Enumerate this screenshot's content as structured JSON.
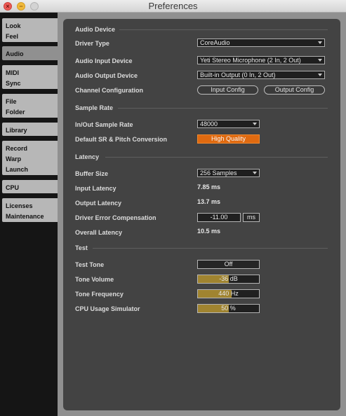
{
  "window": {
    "title": "Preferences"
  },
  "sidebar": {
    "tabs": [
      {
        "lines": [
          "Look",
          "Feel"
        ]
      },
      {
        "lines": [
          "Audio"
        ]
      },
      {
        "lines": [
          "MIDI",
          "Sync"
        ]
      },
      {
        "lines": [
          "File",
          "Folder"
        ]
      },
      {
        "lines": [
          "Library"
        ]
      },
      {
        "lines": [
          "Record",
          "Warp",
          "Launch"
        ]
      },
      {
        "lines": [
          "CPU"
        ]
      },
      {
        "lines": [
          "Licenses",
          "Maintenance"
        ]
      }
    ]
  },
  "audio_device": {
    "section": "Audio Device",
    "driver_type_label": "Driver Type",
    "driver_type_value": "CoreAudio",
    "input_device_label": "Audio Input Device",
    "input_device_value": "Yeti Stereo Microphone (2 In, 2 Out)",
    "output_device_label": "Audio Output Device",
    "output_device_value": "Built-in Output (0 In, 2 Out)",
    "channel_config_label": "Channel Configuration",
    "input_config_button": "Input Config",
    "output_config_button": "Output Config"
  },
  "sample_rate": {
    "section": "Sample Rate",
    "in_out_label": "In/Out Sample Rate",
    "in_out_value": "48000",
    "default_sr_label": "Default SR & Pitch Conversion",
    "default_sr_value": "High Quality"
  },
  "latency": {
    "section": "Latency",
    "buffer_size_label": "Buffer Size",
    "buffer_size_value": "256 Samples",
    "input_latency_label": "Input Latency",
    "input_latency_value": "7.85 ms",
    "output_latency_label": "Output Latency",
    "output_latency_value": "13.7 ms",
    "driver_error_label": "Driver Error Compensation",
    "driver_error_value": "-11.00",
    "driver_error_unit": "ms",
    "overall_latency_label": "Overall Latency",
    "overall_latency_value": "10.5 ms"
  },
  "test": {
    "section": "Test",
    "test_tone_label": "Test Tone",
    "test_tone_value": "Off",
    "tone_volume_label": "Tone Volume",
    "tone_volume_value": "-36 dB",
    "tone_volume_fill": 0.5,
    "tone_frequency_label": "Tone Frequency",
    "tone_frequency_value": "440 Hz",
    "tone_frequency_fill": 0.55,
    "cpu_sim_label": "CPU Usage Simulator",
    "cpu_sim_value": "50 %",
    "cpu_sim_fill": 0.5
  },
  "colors": {
    "accent": "#e06a10",
    "fill": "#a08430"
  }
}
